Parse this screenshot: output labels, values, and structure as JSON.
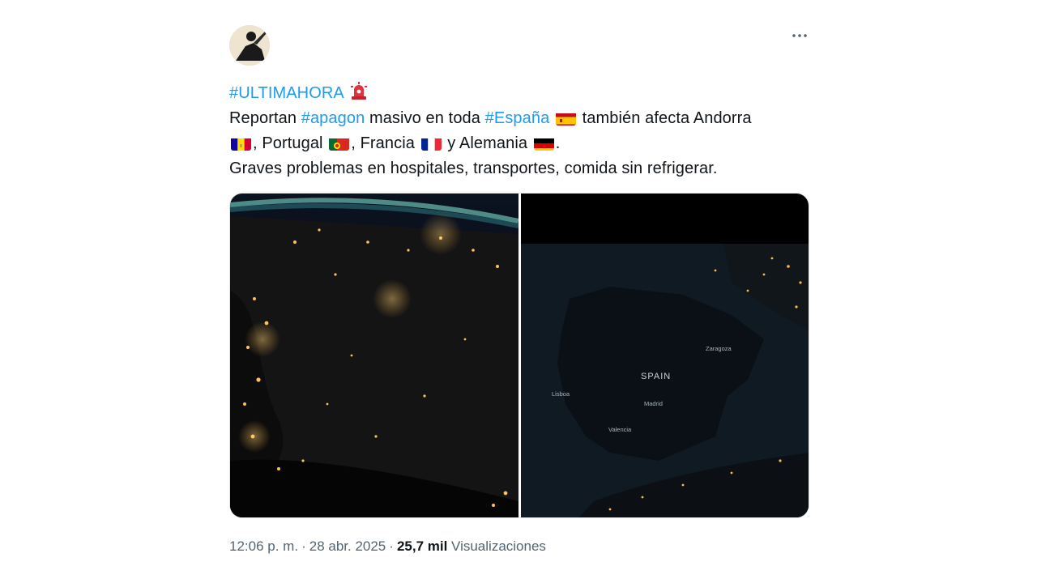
{
  "post": {
    "avatar_icon": "user-avatar",
    "more_icon": "more-options-icon",
    "line1": {
      "hashtag": "#ULTIMAHORA",
      "emoji_icon": "police-siren-icon"
    },
    "line2": {
      "t1": "Reportan ",
      "hashtag1": "#apagon",
      "t2": " masivo en toda ",
      "hashtag2": "#España",
      "t3": "  también afecta Andorra"
    },
    "line3": {
      "t1": ", Portugal ",
      "t2": ", Francia ",
      "t3": " y Alemania ",
      "t4": "."
    },
    "line4": "Graves problemas en hospitales, transportes, comida sin refrigerar.",
    "flags": [
      "spain-flag-icon",
      "andorra-flag-icon",
      "portugal-flag-icon",
      "france-flag-icon",
      "germany-flag-icon"
    ]
  },
  "media": {
    "image_right_labels": {
      "country": "SPAIN",
      "city1": "Zaragoza",
      "city2": "Lisboa",
      "city3": "Madrid",
      "city4": "Valencia"
    }
  },
  "meta": {
    "time": "12:06 p. m.",
    "separator": "·",
    "date": "28 abr. 2025",
    "views_count": "25,7 mil",
    "views_label": "Visualizaciones"
  },
  "colors": {
    "hashtag": "#1d9bf0",
    "meta_text": "#536471",
    "text": "#0f1419"
  }
}
